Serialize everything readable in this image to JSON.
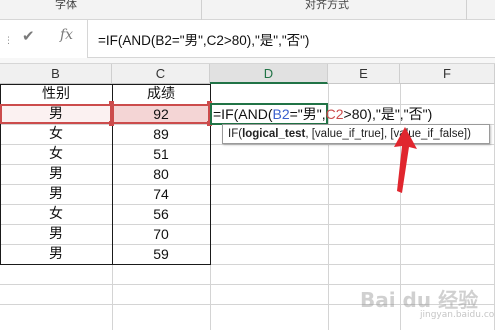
{
  "ribbon": {
    "group_font": "字体",
    "group_align": "对齐方式"
  },
  "formula_bar": {
    "check_icon": "✔",
    "fx_label": "fx",
    "formula": "=IF(AND(B2=\"男\",C2>80),\"是\",\"否\")"
  },
  "columns": [
    "B",
    "C",
    "D",
    "E",
    "F"
  ],
  "headers": {
    "b": "性别",
    "c": "成绩"
  },
  "rows": [
    {
      "gender": "男",
      "score": "92"
    },
    {
      "gender": "女",
      "score": "89"
    },
    {
      "gender": "女",
      "score": "51"
    },
    {
      "gender": "男",
      "score": "80"
    },
    {
      "gender": "男",
      "score": "74"
    },
    {
      "gender": "女",
      "score": "56"
    },
    {
      "gender": "男",
      "score": "70"
    },
    {
      "gender": "男",
      "score": "59"
    }
  ],
  "edit": {
    "p1": "=IF(AND(",
    "p2": "B2",
    "p3": "=\"男\",",
    "p4": "C2",
    "p5": ">80),\"是\",\"否\")"
  },
  "tooltip": {
    "fn": "IF(",
    "arg1": "logical_test",
    "rest": ", [value_if_true], [value_if_false])"
  },
  "watermark": {
    "main": "Bai du 经验",
    "sub": "jingyan.baidu.com"
  },
  "colors": {
    "accent": "#217346",
    "ref_b2": "#3a5fcd",
    "ref_c2": "#cc4c4c",
    "arrow": "#e0262e"
  }
}
